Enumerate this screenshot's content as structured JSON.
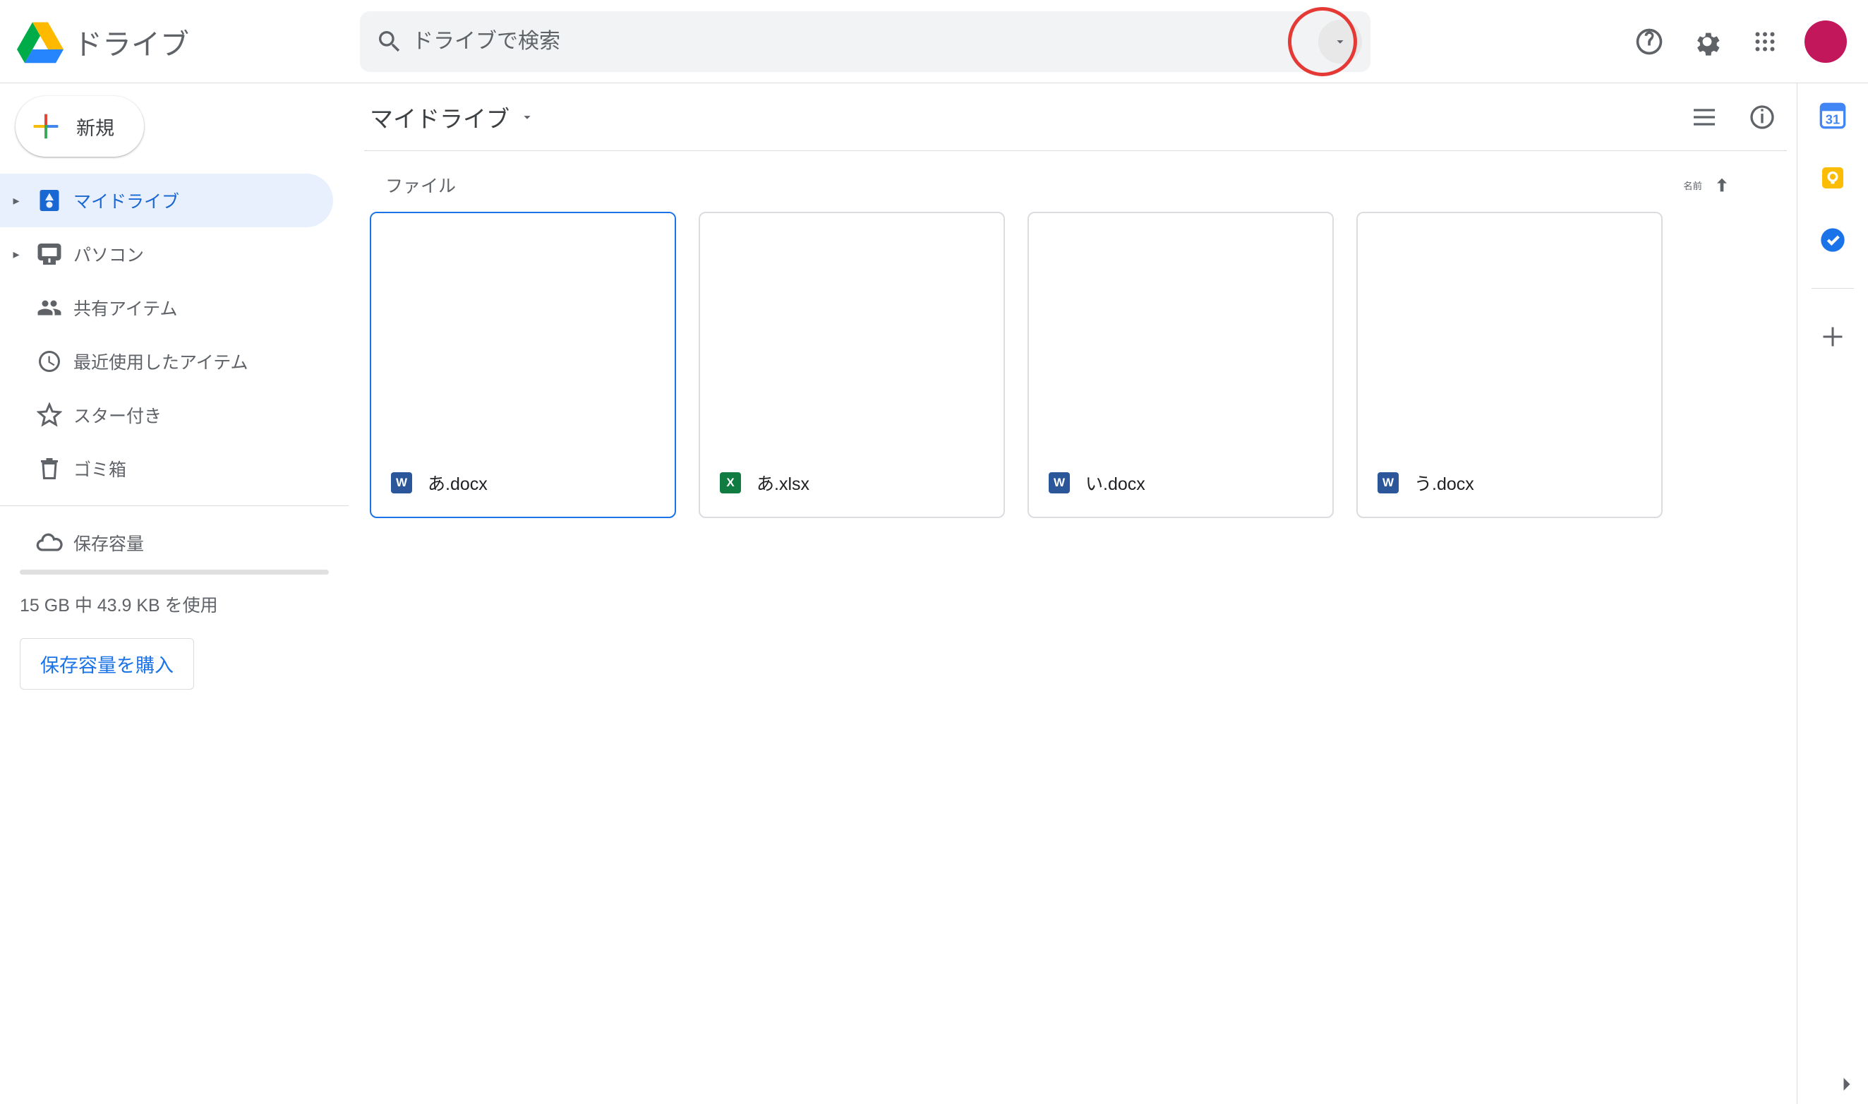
{
  "app_name": "ドライブ",
  "search": {
    "placeholder": "ドライブで検索"
  },
  "avatar_color": "#c2185b",
  "new_button": "新規",
  "sidebar": {
    "items": {
      "mydrive": {
        "label": "マイドライブ"
      },
      "computers": {
        "label": "パソコン"
      },
      "shared": {
        "label": "共有アイテム"
      },
      "recent": {
        "label": "最近使用したアイテム"
      },
      "starred": {
        "label": "スター付き"
      },
      "trash": {
        "label": "ゴミ箱"
      },
      "storage": {
        "label": "保存容量"
      }
    },
    "storage_text": "15 GB 中 43.9 KB を使用",
    "buy_button": "保存容量を購入"
  },
  "breadcrumb": "マイドライブ",
  "section_label": "ファイル",
  "sort_label": "名前",
  "files": {
    "0": {
      "name": "あ.docx",
      "type": "doc",
      "selected": true
    },
    "1": {
      "name": "あ.xlsx",
      "type": "xls",
      "selected": false
    },
    "2": {
      "name": "い.docx",
      "type": "doc",
      "selected": false
    },
    "3": {
      "name": "う.docx",
      "type": "doc",
      "selected": false
    }
  },
  "icon_letters": {
    "doc": "W",
    "xls": "X"
  }
}
